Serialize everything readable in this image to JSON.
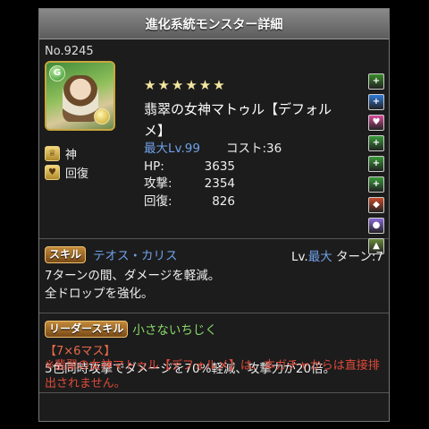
{
  "header": {
    "title": "進化系統モンスター詳細"
  },
  "monster": {
    "number": "No.9245",
    "stars": "★★★★★★",
    "name": "翡翠の女神マトゥル【デフォルメ】",
    "max_lv": "最大Lv.99",
    "cost": "コスト:36",
    "hp_label": "HP:",
    "hp": "3635",
    "atk_label": "攻撃:",
    "atk": "2354",
    "rcv_label": "回復:",
    "rcv": "826",
    "types": [
      {
        "label": "神",
        "icon": "god-type-icon"
      },
      {
        "label": "回復",
        "icon": "healer-type-icon"
      }
    ],
    "attributes": {
      "main": "wood-attribute-icon",
      "sub": "light-attribute-icon"
    }
  },
  "awakenings": [
    {
      "icon": "skill-boost-plus-icon",
      "color": "#3a8a2a"
    },
    {
      "icon": "enhanced-wood-orb-plus-icon",
      "color": "#2f7ad8"
    },
    {
      "icon": "enhanced-heart-orb-icon",
      "color": "#d84a9a"
    },
    {
      "icon": "enhanced-wood-orb-icon",
      "color": "#3a9a3a"
    },
    {
      "icon": "enhanced-wood-orb-icon",
      "color": "#3a9a3a"
    },
    {
      "icon": "enhanced-wood-orb-icon",
      "color": "#3a9a3a"
    },
    {
      "icon": "enhanced-combo-icon",
      "color": "#c84a2a"
    },
    {
      "icon": "multi-color-icon",
      "color": "#8a6ad8"
    },
    {
      "icon": "guard-break-icon",
      "color": "#6a8a3a"
    }
  ],
  "skill": {
    "badge": "スキル",
    "name": "テオス・カリス",
    "lv_prefix": "Lv.",
    "lv": "最大",
    "turn": "ターン:7",
    "desc1": "7ターンの間、ダメージを軽減。",
    "desc2": "全ドロップを強化。"
  },
  "leader": {
    "badge": "リーダースキル",
    "name": "小さないちじく",
    "tag": "【7×6マス】",
    "desc": "5色同時攻撃でダメージを70%軽減、攻撃力が20倍。"
  },
  "note": "※翡翠の女神マトゥル【デフォルメ】は、本ガチャからは直接排出されません。"
}
